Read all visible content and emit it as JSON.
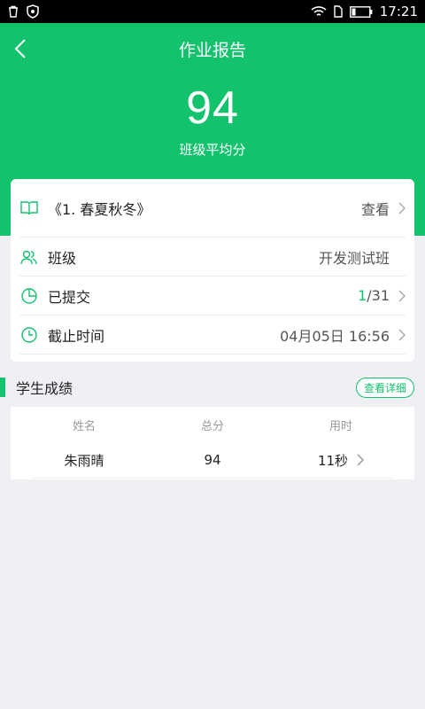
{
  "status_bar": {
    "time": "17:21"
  },
  "header": {
    "title": "作业报告",
    "score": "94",
    "score_label": "班级平均分"
  },
  "info": {
    "book": {
      "label": "《1. 春夏秋冬》",
      "action": "查看"
    },
    "class": {
      "label": "班级",
      "value": "开发测试班"
    },
    "submitted": {
      "label": "已提交",
      "done": "1",
      "total": "/31"
    },
    "deadline": {
      "label": "截止时间",
      "value": "04月05日 16:56"
    }
  },
  "scores_section": {
    "title": "学生成绩",
    "detail_button": "查看详细",
    "columns": [
      "姓名",
      "总分",
      "用时"
    ],
    "rows": [
      {
        "name": "朱雨晴",
        "score": "94",
        "time": "11秒"
      }
    ]
  },
  "colors": {
    "accent": "#12c26d",
    "background": "#eef0f3"
  }
}
